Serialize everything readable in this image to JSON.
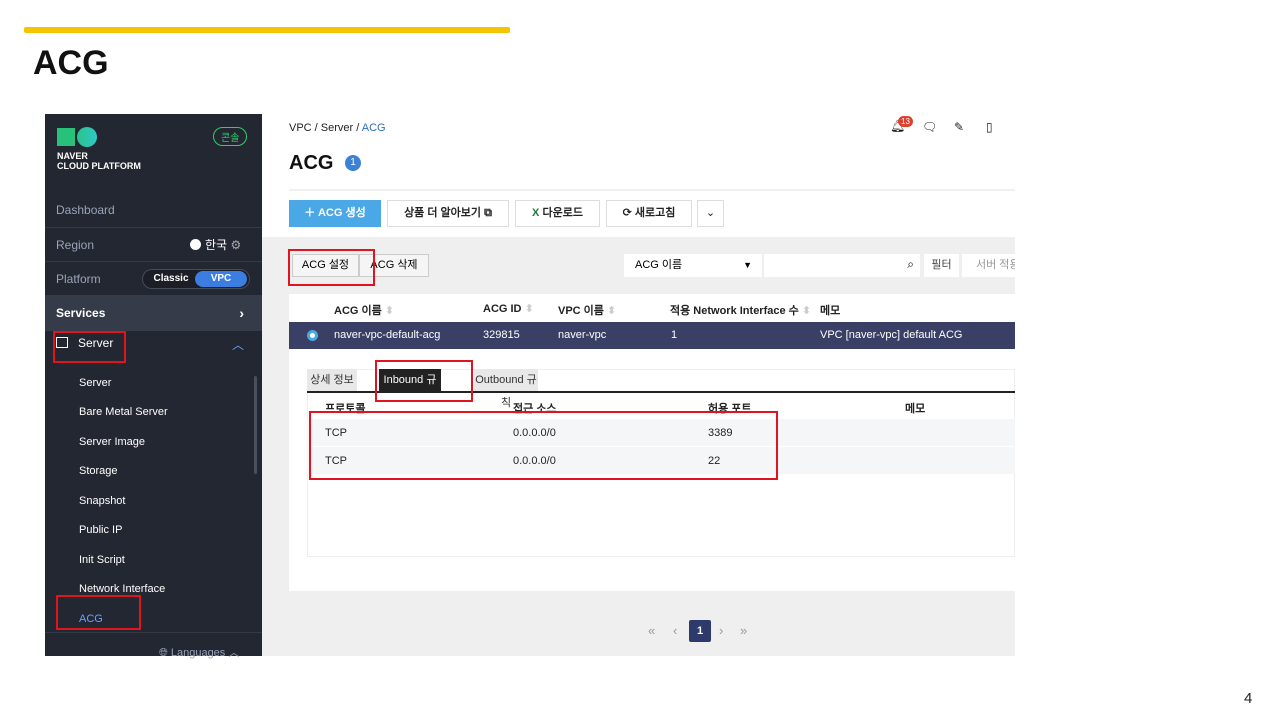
{
  "slide": {
    "title": "ACG",
    "page_number": "4"
  },
  "sidebar": {
    "logo_line1": "NAVER",
    "logo_line2": "CLOUD PLATFORM",
    "console_label": "콘솔",
    "dashboard": "Dashboard",
    "region_label": "Region",
    "region_value": "한국",
    "platform_label": "Platform",
    "platform_options": [
      "Classic",
      "VPC"
    ],
    "platform_selected": "VPC",
    "services": "Services",
    "server_group": "Server",
    "items": [
      "Server",
      "Bare Metal Server",
      "Server Image",
      "Storage",
      "Snapshot",
      "Public IP",
      "Init Script",
      "Network Interface",
      "ACG"
    ],
    "active_item": "ACG",
    "languages": "Languages"
  },
  "header": {
    "breadcrumb": [
      "VPC",
      "Server",
      "ACG"
    ],
    "title": "ACG",
    "count": "1",
    "notification_count": "13"
  },
  "toolbar": {
    "create": "ACG 생성",
    "learn_more": "상품 더 알아보기",
    "download": "다운로드",
    "refresh": "새로고침"
  },
  "actions": {
    "settings": "ACG 설정",
    "delete": "ACG 삭제",
    "search_field": "ACG 이름",
    "filter": "필터",
    "server_apply": "서버 적용"
  },
  "table": {
    "headers": [
      "ACG 이름",
      "ACG ID",
      "VPC 이름",
      "적용 Network Interface 수",
      "메모"
    ],
    "rows": [
      {
        "name": "naver-vpc-default-acg",
        "id": "329815",
        "vpc": "naver-vpc",
        "ni_count": "1",
        "memo": "VPC [naver-vpc] default ACG"
      }
    ]
  },
  "detail": {
    "tabs": [
      "상세 정보",
      "Inbound 규칙",
      "Outbound 규칙"
    ],
    "active_tab": "Inbound 규칙",
    "headers": [
      "프로토콜",
      "접근 소스",
      "허용 포트",
      "메모"
    ],
    "rules": [
      {
        "protocol": "TCP",
        "source": "0.0.0.0/0",
        "port": "3389"
      },
      {
        "protocol": "TCP",
        "source": "0.0.0.0/0",
        "port": "22"
      }
    ]
  },
  "pagination": {
    "current": "1"
  },
  "colors": {
    "accent": "#f5c400",
    "highlight": "#e0141e",
    "primary": "#4aa8e6",
    "selected_row": "#3a3f66",
    "sidebar": "#232731"
  }
}
